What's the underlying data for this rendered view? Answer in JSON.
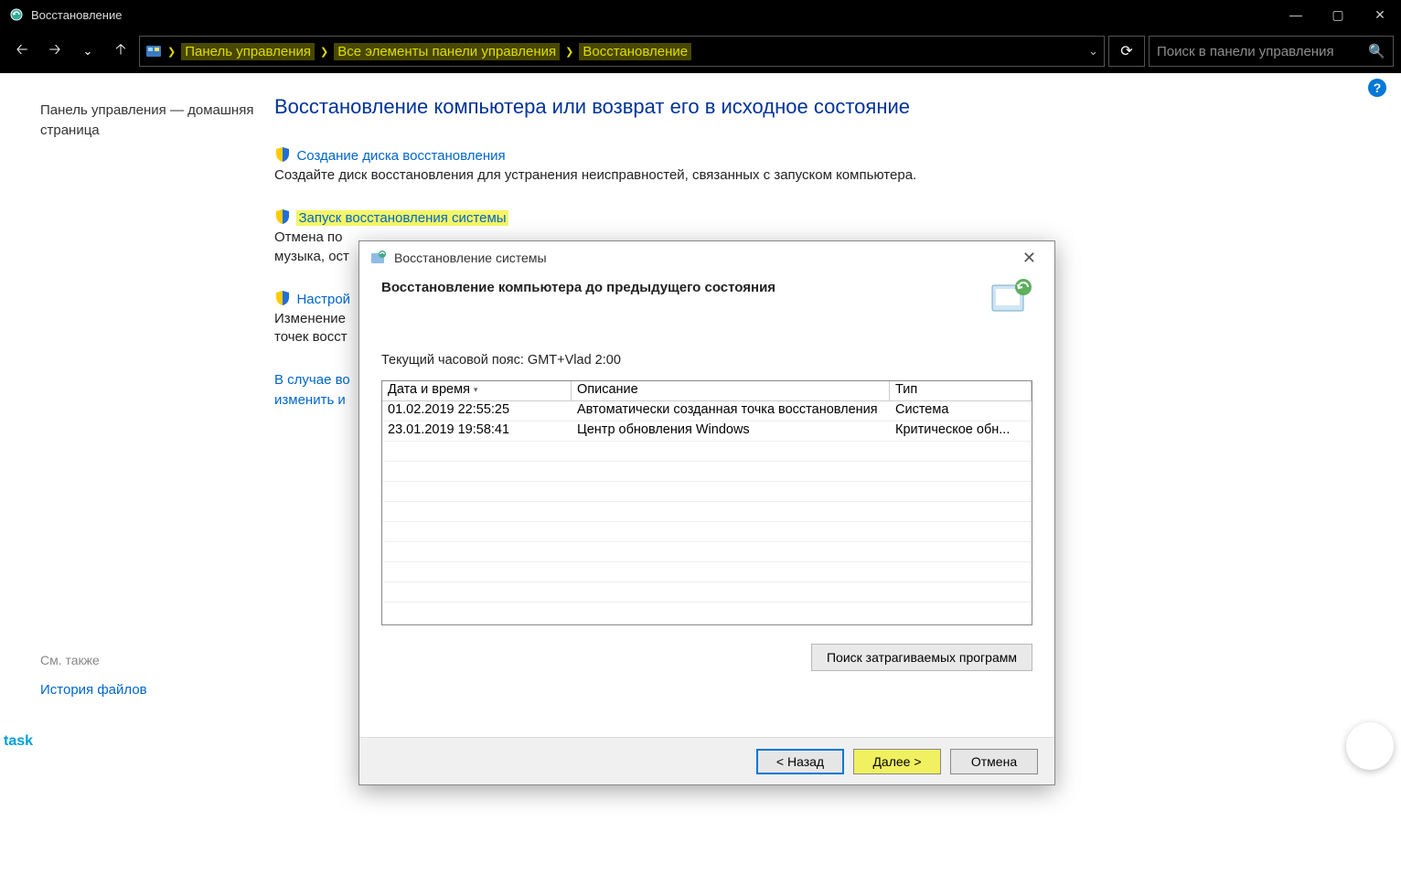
{
  "titlebar": {
    "title": "Восстановление"
  },
  "breadcrumb": {
    "items": [
      "Панель управления",
      "Все элементы панели управления",
      "Восстановление"
    ]
  },
  "search": {
    "placeholder": "Поиск в панели управления"
  },
  "sidebar": {
    "home": "Панель управления — домашняя страница",
    "see_also": "См. также",
    "history": "История файлов"
  },
  "content": {
    "heading": "Восстановление компьютера или возврат его в исходное состояние",
    "items": [
      {
        "link": "Создание диска восстановления",
        "desc": "Создайте диск восстановления для устранения неисправностей, связанных с запуском компьютера.",
        "hl": false
      },
      {
        "link": "Запуск восстановления системы",
        "desc": "Отмена по\nмузыка, ост",
        "hl": true,
        "split_desc_a": "Отмена по",
        "split_desc_b": "музыка, ост"
      },
      {
        "link": "Настрой",
        "desc": "Изменение\nточек восст",
        "split_desc_a": "Изменение",
        "split_desc_b": "точек восст",
        "hl": false
      }
    ],
    "also_a": "В случае во",
    "also_b": "изменить и"
  },
  "dialog": {
    "win_title": "Восстановление системы",
    "title": "Восстановление компьютера до предыдущего состояния",
    "tz": "Текущий часовой пояс: GMT+Vlad 2:00",
    "columns": [
      "Дата и время",
      "Описание",
      "Тип"
    ],
    "rows": [
      {
        "dt": "01.02.2019 22:55:25",
        "desc": "Автоматически созданная точка восстановления",
        "type": "Система"
      },
      {
        "dt": "23.01.2019 19:58:41",
        "desc": "Центр обновления Windows",
        "type": "Критическое обн..."
      }
    ],
    "affected": "Поиск затрагиваемых программ",
    "back": "< Назад",
    "next": "Далее >",
    "cancel": "Отмена"
  },
  "task": "task"
}
